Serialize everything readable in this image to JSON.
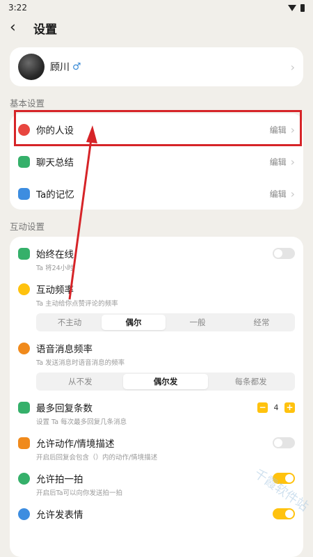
{
  "status_bar": {
    "time": "3:22"
  },
  "nav": {
    "title": "设置"
  },
  "profile": {
    "name": "顾川",
    "gender_symbol": "♂"
  },
  "sections": {
    "basic_label": "基本设置",
    "interaction_label": "互动设置"
  },
  "basic_settings": [
    {
      "label": "你的人设",
      "action": "编辑",
      "icon": "heart-badge-icon",
      "color": "#e8463f"
    },
    {
      "label": "聊天总结",
      "action": "编辑",
      "icon": "chat-summary-icon",
      "color": "#35b06a"
    },
    {
      "label": "Ta的记忆",
      "action": "编辑",
      "icon": "memory-icon",
      "color": "#3d8de0"
    }
  ],
  "interaction_settings": {
    "always_online": {
      "title": "始终在线",
      "desc": "Ta 将24小时",
      "enabled": false,
      "icon": "online-icon",
      "color": "#35b06a"
    },
    "interaction_freq": {
      "title": "互动频率",
      "desc": "Ta 主动给你点赞评论的频率",
      "options": [
        "不主动",
        "偶尔",
        "一般",
        "经常"
      ],
      "selected": "偶尔",
      "icon": "wave-icon",
      "color": "#ffc20e"
    },
    "voice_freq": {
      "title": "语音消息频率",
      "desc": "Ta 发送消息时语音消息的频率",
      "options": [
        "从不发",
        "偶尔发",
        "每条都发"
      ],
      "selected": "偶尔发",
      "icon": "voice-bubble-icon",
      "color": "#f08a1c"
    },
    "max_replies": {
      "title": "最多回复条数",
      "desc": "设置 Ta 每次最多回复几条消息",
      "value": "4",
      "minus": "−",
      "plus": "+",
      "icon": "reply-count-icon",
      "color": "#35b06a"
    },
    "allow_action": {
      "title": "允许动作/情境描述",
      "desc": "开启后回复会包含（）内的动作/情境描述",
      "enabled": false,
      "icon": "action-icon",
      "color": "#f08a1c"
    },
    "allow_pat": {
      "title": "允许拍一拍",
      "desc": "开启后Ta可以向你发送拍一拍",
      "enabled": true,
      "icon": "hand-wave-icon",
      "color": "#35b06a"
    },
    "allow_sticker": {
      "title": "允许发表情",
      "enabled": true,
      "icon": "emoji-icon",
      "color": "#3d8de0"
    }
  },
  "watermark": {
    "text": "千霞软件站"
  },
  "annotation": {
    "highlight_color": "#d62428"
  }
}
